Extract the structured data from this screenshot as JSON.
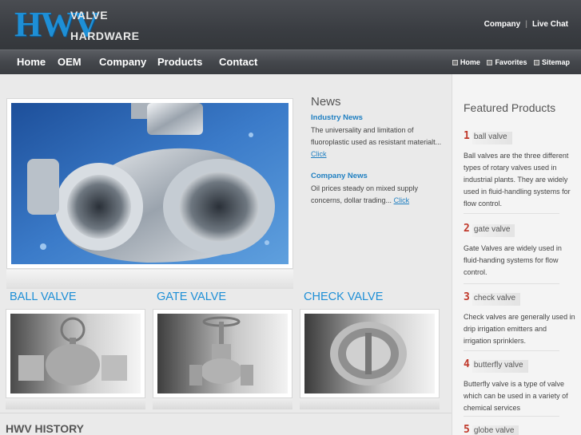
{
  "logo": {
    "hwv": "HWV",
    "line1": "VALVE",
    "line2": "HARDWARE"
  },
  "toplinks": {
    "company": "Company",
    "livechat": "Live Chat"
  },
  "nav": {
    "items": [
      "Home",
      "OEM",
      "Company",
      "Products",
      "Contact"
    ],
    "right": [
      "Home",
      "Favorites",
      "Sitemap"
    ]
  },
  "news": {
    "title": "News",
    "industry_title": "Industry News",
    "industry_text": "The universality and limitation of fluoroplastic used as resistant materialt...",
    "industry_link": "Click",
    "company_title": "Company News",
    "company_text": "Oil prices steady on mixed supply concerns, dollar trading...",
    "company_link": "Click"
  },
  "categories": [
    "BALL VALVE",
    "GATE VALVE",
    "CHECK VALVE"
  ],
  "history_title": "HWV HISTORY",
  "sidebar": {
    "title": "Featured Products",
    "products": [
      {
        "num": "1",
        "name": "ball valve",
        "desc": "Ball valves are the three different types of rotary valves used in industrial plants. They are widely used in fluid-handling systems for flow control."
      },
      {
        "num": "2",
        "name": "gate valve",
        "desc": "Gate Valves are widely used in fluid-handing systems for flow control."
      },
      {
        "num": "3",
        "name": "check valve",
        "desc": "Check valves are generally used in drip irrigation emitters and irrigation sprinklers."
      },
      {
        "num": "4",
        "name": "butterfly valve",
        "desc": "Butterfly valve is a type of valve which can be used in a variety of chemical services"
      },
      {
        "num": "5",
        "name": "globe valve",
        "desc": ""
      }
    ]
  },
  "colors": {
    "accent": "#1e8fd6",
    "header": "#3a3d42",
    "number": "#c0392b"
  }
}
